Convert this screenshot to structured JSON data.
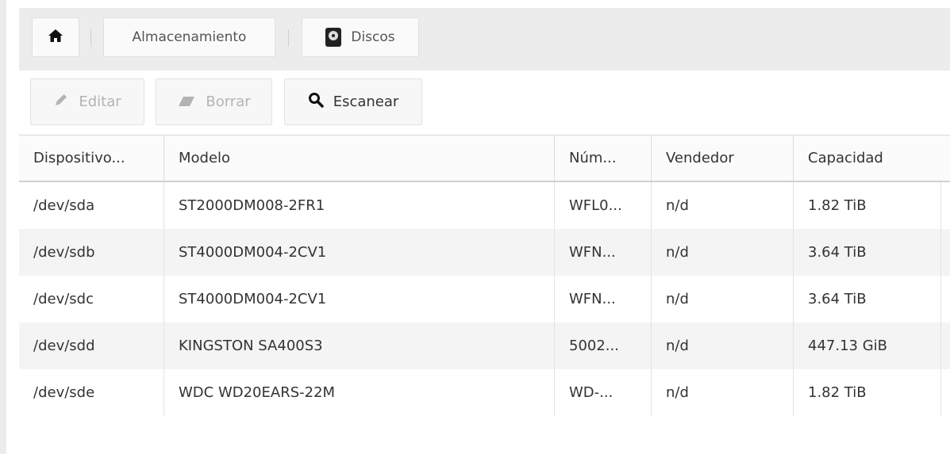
{
  "breadcrumb": {
    "home_icon": "home-icon",
    "storage_label": "Almacenamiento",
    "disks_label": "Discos",
    "disks_icon": "hard-disk-icon"
  },
  "toolbar": {
    "edit_label": "Editar",
    "edit_icon": "pencil-icon",
    "delete_label": "Borrar",
    "delete_icon": "eraser-icon",
    "scan_label": "Escanear",
    "scan_icon": "search-icon"
  },
  "table": {
    "columns": [
      "Dispositivo...",
      "Modelo",
      "Núm...",
      "Vendedor",
      "Capacidad"
    ],
    "rows": [
      {
        "device": "/dev/sda",
        "model": "ST2000DM008-2FR1",
        "serial": "WFL0...",
        "vendor": "n/d",
        "capacity": "1.82 TiB"
      },
      {
        "device": "/dev/sdb",
        "model": "ST4000DM004-2CV1",
        "serial": "WFN...",
        "vendor": "n/d",
        "capacity": "3.64 TiB"
      },
      {
        "device": "/dev/sdc",
        "model": "ST4000DM004-2CV1",
        "serial": "WFN...",
        "vendor": "n/d",
        "capacity": "3.64 TiB"
      },
      {
        "device": "/dev/sdd",
        "model": "KINGSTON SA400S3",
        "serial": "5002...",
        "vendor": "n/d",
        "capacity": "447.13 GiB"
      },
      {
        "device": "/dev/sde",
        "model": "WDC WD20EARS-22M",
        "serial": "WD-...",
        "vendor": "n/d",
        "capacity": "1.82 TiB"
      }
    ]
  },
  "colors": {
    "toolbar_bg": "#ececec",
    "alt_row_bg": "#f4f4f4",
    "disabled_text": "#b3b3b3"
  }
}
